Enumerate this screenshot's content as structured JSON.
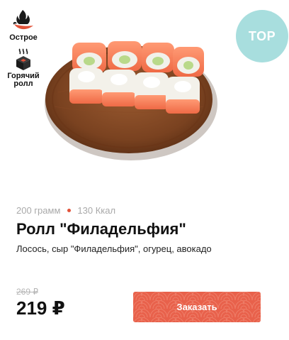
{
  "badges": [
    {
      "label": "Острое",
      "icon": "chili-flame-icon"
    },
    {
      "label": "Горячий ролл",
      "icon": "hot-roll-icon"
    }
  ],
  "top_badge": {
    "label": "TOP",
    "color": "#a8dede"
  },
  "product": {
    "image": "sushi-roll-plate-image",
    "weight": "200 грамм",
    "calories": "130 Ккал",
    "title": "Ролл \"Филадельфия\"",
    "description": "Лосось, сыр \"Филадельфия\", огурец, авокадо",
    "old_price": "269 ₽",
    "price": "219 ₽"
  },
  "order_button": {
    "label": "Заказать",
    "color": "#e8614b"
  },
  "colors": {
    "accent": "#e2533a",
    "muted": "#a9a9a9"
  }
}
